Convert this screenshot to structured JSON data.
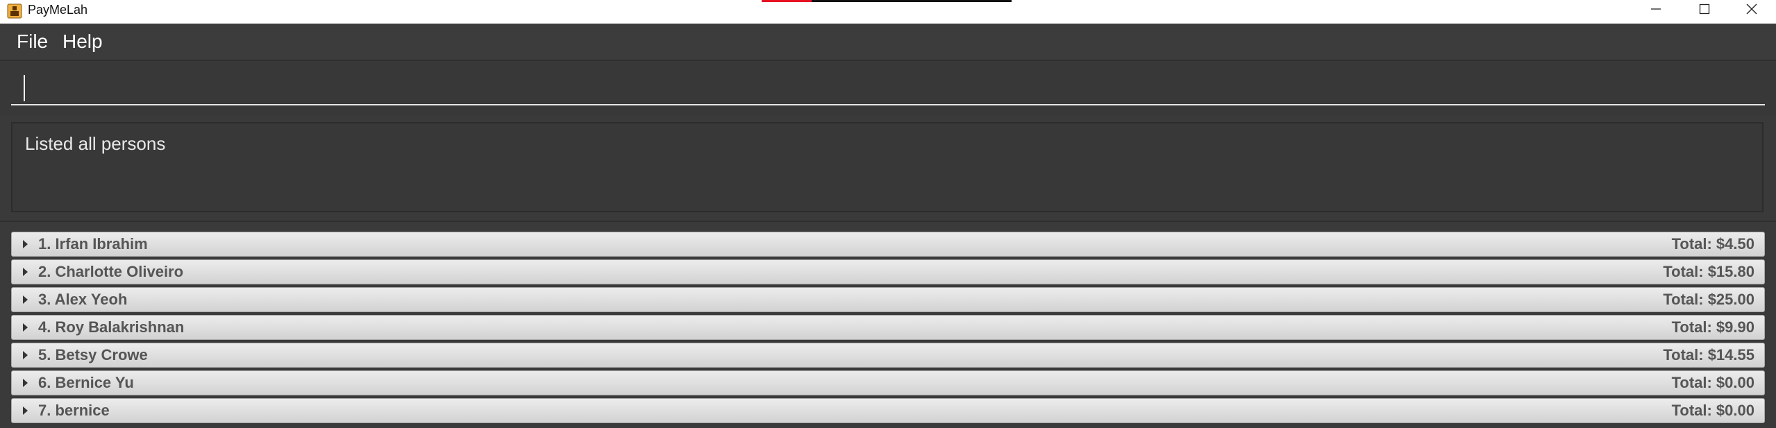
{
  "window": {
    "title": "PayMeLah",
    "icon": "app-icon",
    "controls": [
      "minimize-icon",
      "maximize-icon",
      "close-icon"
    ]
  },
  "menu": {
    "file_label": "File",
    "help_label": "Help"
  },
  "command": {
    "value": "",
    "placeholder": ""
  },
  "result": {
    "message": "Listed all persons"
  },
  "persons": [
    {
      "name": "1. Irfan Ibrahim",
      "total": "Total: $4.50"
    },
    {
      "name": "2. Charlotte Oliveiro",
      "total": "Total: $15.80"
    },
    {
      "name": "3. Alex Yeoh",
      "total": "Total: $25.00"
    },
    {
      "name": "4. Roy Balakrishnan",
      "total": "Total: $9.90"
    },
    {
      "name": "5. Betsy Crowe",
      "total": "Total: $14.55"
    },
    {
      "name": "6. Bernice Yu",
      "total": "Total: $0.00"
    },
    {
      "name": "7. bernice",
      "total": "Total: $0.00"
    }
  ],
  "colors": {
    "background": "#3a3a3a",
    "row": "#dedede",
    "row_text": "#555555",
    "menu_text": "#ffffff"
  }
}
